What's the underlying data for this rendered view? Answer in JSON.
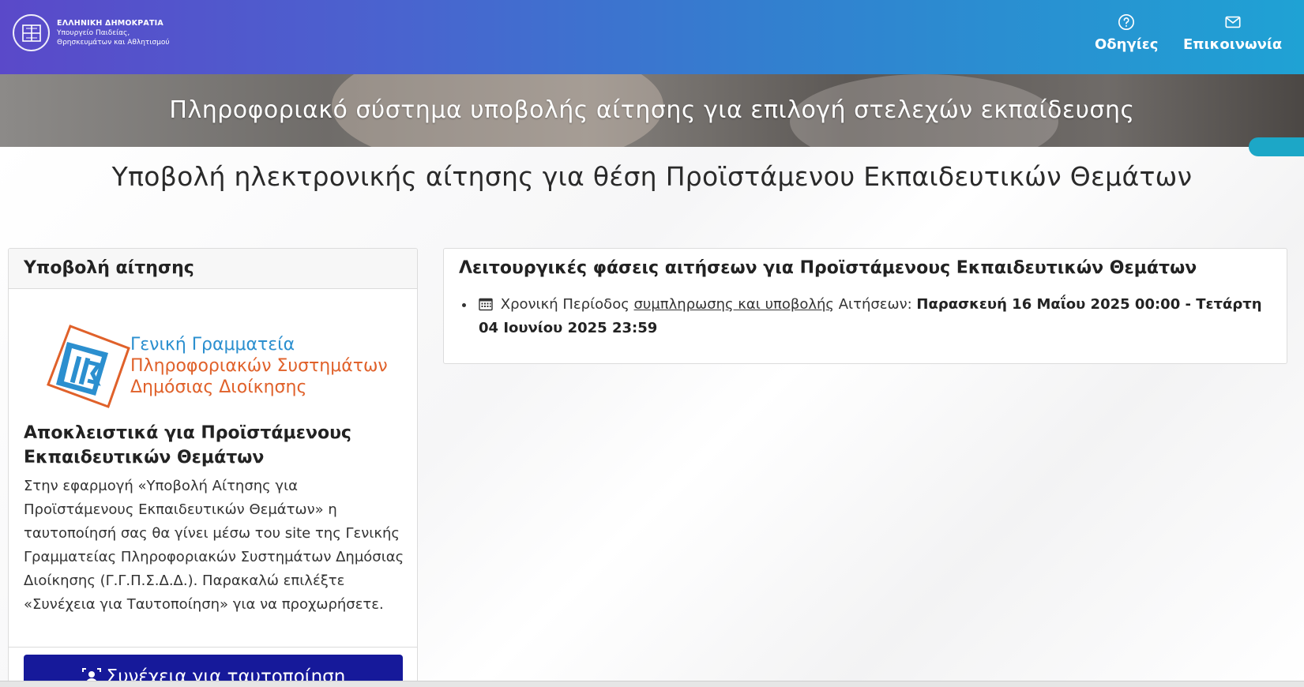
{
  "header": {
    "logo_line1": "ΕΛΛΗΝΙΚΗ ΔΗΜΟΚΡΑΤΙΑ",
    "logo_line2": "Υπουργείο Παιδείας,",
    "logo_line3": "Θρησκευμάτων και Αθλητισμού",
    "nav_help": "Οδηγίες",
    "nav_contact": "Επικοινωνία"
  },
  "hero": {
    "title": "Πληροφοριακό σύστημα υποβολής αίτησης για επιλογή στελεχών εκπαίδευσης"
  },
  "page_title": "Υποβολή ηλεκτρονικής αίτησης για θέση Προϊστάμενου Εκπαιδευτικών Θεμάτων",
  "left_card": {
    "header": "Υποβολή αίτησης",
    "org_line1": "Γενική Γραμματεία",
    "org_line2": "Πληροφοριακών Συστημάτων",
    "org_line3": "Δημόσιας Διοίκησης",
    "heading": "Αποκλειστικά για Προϊστάμενους Εκπαιδευτικών Θεμάτων",
    "text": "Στην εφαρμογή «Υποβολή Αίτησης για Προϊστάμενους Εκπαιδευτικών Θεμάτων» η ταυτοποίησή σας θα γίνει μέσω του site της Γενικής Γραμματείας Πληροφοριακών Συστημάτων Δημόσιας Διοίκησης (Γ.Γ.Π.Σ.Δ.Δ.). Παρακαλώ επιλέξτε «Συνέχεια για Ταυτοποίηση» για να προχωρήσετε.",
    "button": "Συνέχεια για ταυτοποίηση"
  },
  "right_card": {
    "heading": "Λειτουργικές φάσεις αιτήσεων για Προϊστάμενους Εκπαιδευτικών Θεμάτων",
    "item_prefix": "Χρονική Περίοδος",
    "item_underlined": "συμπληρωσης και υποβολής",
    "item_suffix": "Αιτήσεων:",
    "item_dates": "Παρασκευή 16 Μαΐου 2025 00:00 - Τετάρτη 04 Ιουνίου 2025 23:59"
  },
  "colors": {
    "header_gradient_start": "#5a49c9",
    "header_gradient_end": "#1fa2d4",
    "button_bg": "#16199a",
    "org_blue": "#2b8fcf",
    "org_orange": "#e0612a"
  },
  "icons": {
    "logo": "greek-seal-icon",
    "help": "question-circle-icon",
    "contact": "envelope-icon",
    "button": "user-badge-icon",
    "calendar": "calendar-icon"
  }
}
